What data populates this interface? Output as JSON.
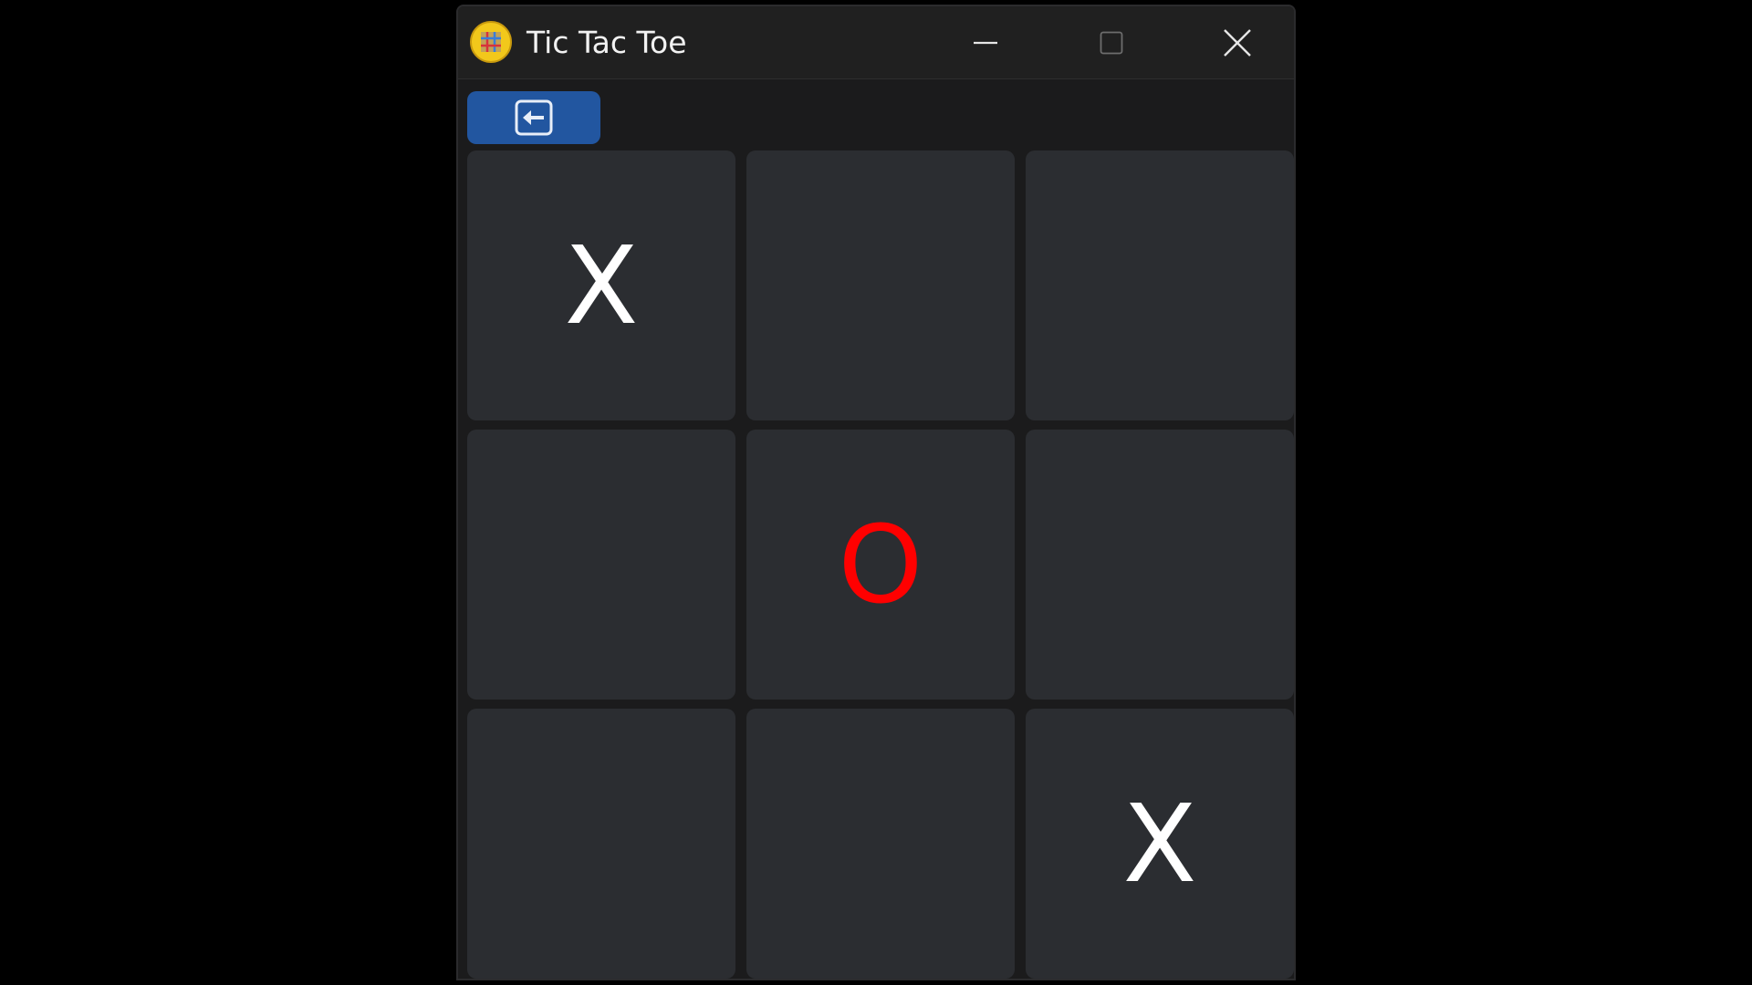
{
  "window": {
    "title": "Tic Tac Toe",
    "icon": "tic-tac-toe-app-icon"
  },
  "title_bar_controls": {
    "minimize_icon": "minimize-icon",
    "maximize_icon": "maximize-icon",
    "close_icon": "close-icon"
  },
  "toolbar": {
    "back_icon": "back-arrow-icon",
    "accent_color": "#2256a0"
  },
  "board": {
    "rows": 3,
    "cols": 3,
    "cells": [
      "X",
      "",
      "",
      "",
      "O",
      "",
      "",
      "",
      "X"
    ],
    "x_color": "#ffffff",
    "o_color": "#ff0000",
    "cell_color": "#2b2d31"
  }
}
